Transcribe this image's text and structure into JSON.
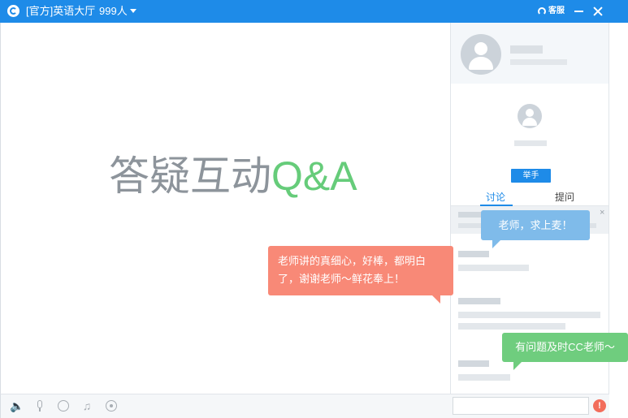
{
  "titlebar": {
    "room_title": "[官方]英语大厅",
    "member_count": "999人",
    "service_label": "客服"
  },
  "stage": {
    "title_main": "答疑互动",
    "title_accent": "Q&A"
  },
  "side": {
    "raise_hand_label": "举手",
    "tabs": [
      {
        "label": "讨论",
        "selected": true
      },
      {
        "label": "提问",
        "selected": false
      }
    ],
    "notice_close": "×"
  },
  "bubbles": {
    "student_message": "老师讲的真细心，好棒，都明白了，谢谢老师～鲜花奉上！",
    "request_message": "老师，求上麦！",
    "tip_message": "有问题及时CC老师～"
  },
  "bottombar": {
    "input_placeholder": ""
  },
  "colors": {
    "accent_blue": "#1e8be8",
    "bubble_red": "#f88977",
    "bubble_blue": "#7fbbea",
    "bubble_green": "#6fcd7e",
    "title_accent_green": "#66cc7a"
  }
}
